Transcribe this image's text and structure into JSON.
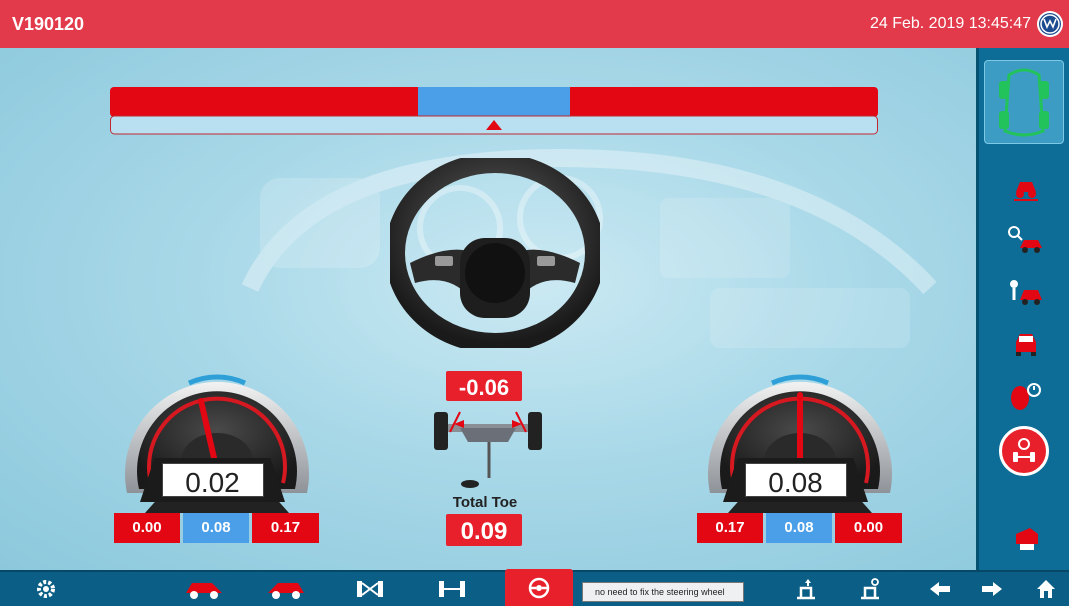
{
  "header": {
    "title": "V190120",
    "datetime": "24 Feb. 2019 13:45:47"
  },
  "center": {
    "toe_top_value": "-0.06",
    "total_toe_label": "Total Toe",
    "total_toe_value": "0.09"
  },
  "left_gauge": {
    "value": "0.02",
    "min": "0.00",
    "mid": "0.08",
    "max": "0.17"
  },
  "right_gauge": {
    "value": "0.08",
    "min": "0.17",
    "mid": "0.08",
    "max": "0.00"
  },
  "tooltip": "no need to fix the steering wheel",
  "colors": {
    "header_red": "#e23a4b",
    "panel_blue": "#0d6d96",
    "bar_red": "#e30613",
    "bar_blue": "#4a9fe8",
    "value_red": "#e8202b"
  },
  "sidebar": {
    "items": [
      "car-overview-icon",
      "car-lift-icon",
      "car-search-icon",
      "car-repair-icon",
      "car-front-icon",
      "wheel-sensor-icon",
      "toe-adjust-icon",
      "printer-icon"
    ]
  },
  "toolbar": {
    "items": [
      "settings-icon",
      "car-rear-icon",
      "car-front-side-icon",
      "axle-icon",
      "axle-alt-icon",
      "steering-wheel-icon",
      "lift-up-icon",
      "lift-down-icon",
      "back-arrow-icon",
      "forward-arrow-icon",
      "home-icon"
    ]
  }
}
